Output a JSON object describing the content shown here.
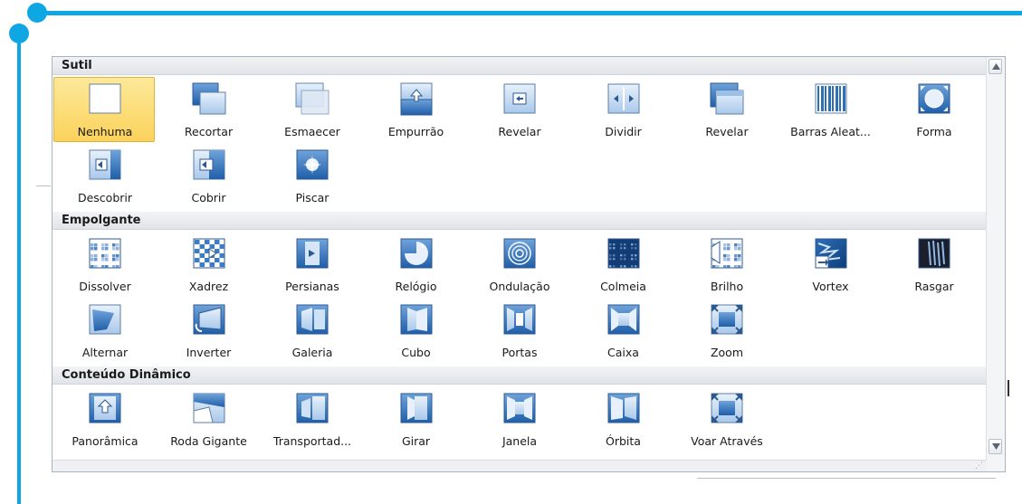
{
  "gallery": {
    "sections": [
      {
        "title": "Sutil",
        "rows": [
          [
            {
              "label": "Nenhuma",
              "icon": "none-transition-icon",
              "selected": true
            },
            {
              "label": "Recortar",
              "icon": "cut-transition-icon"
            },
            {
              "label": "Esmaecer",
              "icon": "fade-transition-icon"
            },
            {
              "label": "Empurrão",
              "icon": "push-transition-icon"
            },
            {
              "label": "Revelar",
              "icon": "wipe-transition-icon"
            },
            {
              "label": "Dividir",
              "icon": "split-transition-icon"
            },
            {
              "label": "Revelar",
              "icon": "reveal-transition-icon"
            },
            {
              "label": "Barras Aleat...",
              "icon": "random-bars-transition-icon"
            },
            {
              "label": "Forma",
              "icon": "shape-transition-icon"
            }
          ],
          [
            {
              "label": "Descobrir",
              "icon": "uncover-transition-icon"
            },
            {
              "label": "Cobrir",
              "icon": "cover-transition-icon"
            },
            {
              "label": "Piscar",
              "icon": "flash-transition-icon"
            }
          ]
        ]
      },
      {
        "title": "Empolgante",
        "rows": [
          [
            {
              "label": "Dissolver",
              "icon": "dissolve-transition-icon"
            },
            {
              "label": "Xadrez",
              "icon": "checkerboard-transition-icon"
            },
            {
              "label": "Persianas",
              "icon": "blinds-transition-icon"
            },
            {
              "label": "Relógio",
              "icon": "clock-transition-icon"
            },
            {
              "label": "Ondulação",
              "icon": "ripple-transition-icon"
            },
            {
              "label": "Colmeia",
              "icon": "honeycomb-transition-icon"
            },
            {
              "label": "Brilho",
              "icon": "glitter-transition-icon"
            },
            {
              "label": "Vortex",
              "icon": "vortex-transition-icon"
            },
            {
              "label": "Rasgar",
              "icon": "shred-transition-icon"
            }
          ],
          [
            {
              "label": "Alternar",
              "icon": "switch-transition-icon"
            },
            {
              "label": "Inverter",
              "icon": "flip-transition-icon"
            },
            {
              "label": "Galeria",
              "icon": "gallery-transition-icon"
            },
            {
              "label": "Cubo",
              "icon": "cube-transition-icon"
            },
            {
              "label": "Portas",
              "icon": "doors-transition-icon"
            },
            {
              "label": "Caixa",
              "icon": "box-transition-icon"
            },
            {
              "label": "Zoom",
              "icon": "zoom-transition-icon"
            }
          ]
        ]
      },
      {
        "title": "Conteúdo Dinâmico",
        "rows": [
          [
            {
              "label": "Panorâmica",
              "icon": "pan-transition-icon"
            },
            {
              "label": "Roda Gigante",
              "icon": "ferris-wheel-transition-icon"
            },
            {
              "label": "Transportad...",
              "icon": "conveyor-transition-icon"
            },
            {
              "label": "Girar",
              "icon": "rotate-transition-icon"
            },
            {
              "label": "Janela",
              "icon": "window-transition-icon"
            },
            {
              "label": "Órbita",
              "icon": "orbit-transition-icon"
            },
            {
              "label": "Voar Através",
              "icon": "fly-through-transition-icon"
            }
          ]
        ]
      }
    ]
  },
  "colors": {
    "accent": "#0fa7e3",
    "selected_fill": "#fbd25b",
    "icon_blue": "#2f6fb8"
  }
}
